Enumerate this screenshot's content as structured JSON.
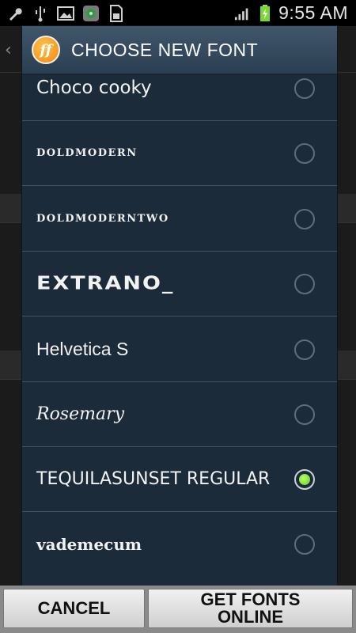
{
  "status_bar": {
    "clock": "9:55 AM",
    "icons_left": [
      "wrench-icon",
      "usb-icon",
      "image-icon",
      "media-icon",
      "sim-icon"
    ],
    "icons_right": [
      "signal-icon",
      "battery-charging-icon",
      "alarm-icon"
    ]
  },
  "dialog": {
    "title": "CHOOSE NEW FONT",
    "logo_text": "ff",
    "fonts": [
      {
        "label": "Choco cooky",
        "selected": false
      },
      {
        "label": "DOLDMODERN",
        "selected": false
      },
      {
        "label": "DOLDMODERNTWO",
        "selected": false
      },
      {
        "label": "EXTRANO_",
        "selected": false
      },
      {
        "label": "Helvetica S",
        "selected": false
      },
      {
        "label": "Rosemary",
        "selected": false
      },
      {
        "label": "TEQUILASUNSET REGULAR",
        "selected": true
      },
      {
        "label": "vademecum",
        "selected": false
      }
    ],
    "buttons": {
      "cancel": "CANCEL",
      "get_fonts": "GET FONTS ONLINE"
    }
  },
  "colors": {
    "dialog_bg": "#1c2b39",
    "header_bg": "#40566b",
    "selected_radio": "#7bd832"
  }
}
